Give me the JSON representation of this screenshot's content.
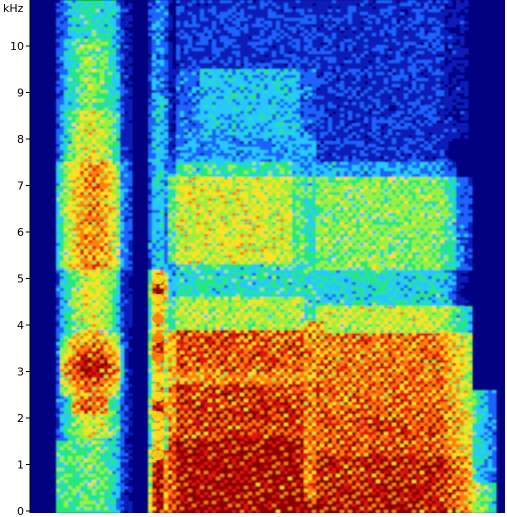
{
  "chart_data": {
    "type": "heatmap",
    "title": "",
    "xlabel": "",
    "ylabel": "kHz",
    "ylim": [
      0,
      11
    ],
    "yticks": [
      0,
      1,
      2,
      3,
      4,
      5,
      6,
      7,
      8,
      9,
      10
    ],
    "ytick_labels": [
      "0",
      "1",
      "2",
      "3",
      "4",
      "5",
      "6",
      "7",
      "8",
      "9",
      "10"
    ],
    "colormap": [
      "#000080",
      "#0a1fb8",
      "#1e64ff",
      "#28c8ff",
      "#28e87a",
      "#9cf03c",
      "#ffe020",
      "#ff8010",
      "#e01808",
      "#8c0000"
    ],
    "background_color": "#000080",
    "grid": false
  }
}
